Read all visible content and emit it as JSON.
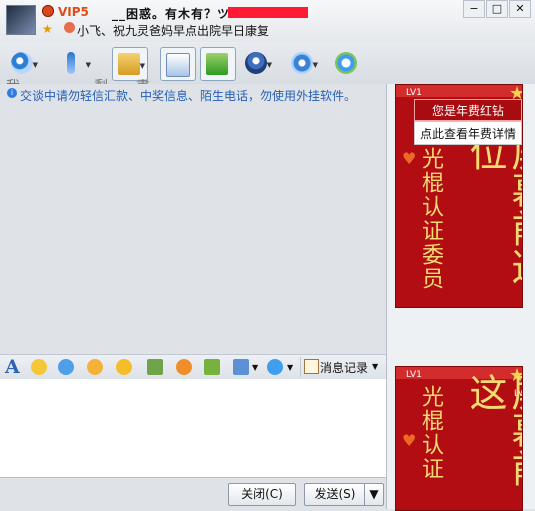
{
  "window": {
    "title": "__困惑。有木有？ツ",
    "vip_badge": "VIP5",
    "signature": "小飞、祝九灵爸妈早点出院早日康复",
    "controls": {
      "minimize": "−",
      "maximize": "□",
      "close": "✕"
    }
  },
  "toolbar": {
    "ghost_text_1": "我",
    "ghost_text_2": "剩",
    "ghost_text_3": "書",
    "icons": [
      "video-call-icon",
      "voice-call-icon",
      "send-file-icon",
      "mail-icon",
      "add-app-icon",
      "police-icon",
      "settings-icon",
      "soso-icon"
    ]
  },
  "notice": "交谈中请勿轻信汇款、中奖信息、陌生电话，勿使用外挂软件。",
  "ad": {
    "popup_vip": "您是年费红钻",
    "popup_detail": "点此查看年费详情",
    "level_badge": "LV1",
    "year_badge": "年",
    "side_text_1": "光棍认证委员",
    "side_text_2": "屏幕前这位",
    "side_text_3": "光棍认证",
    "side_text_4": "屏幕前这"
  },
  "edit_toolbar": {
    "font_label": "A",
    "message_record": "消息记录",
    "icons": [
      "font-icon",
      "emoji-icon",
      "magic-face-icon",
      "emoji-wink-icon",
      "shake-icon",
      "picture-icon",
      "music-icon",
      "score-icon",
      "screenshot-icon",
      "soso-small-icon"
    ]
  },
  "input": {
    "value": ""
  },
  "buttons": {
    "close": "关闭(C)",
    "send": "发送(S)",
    "send_menu": "▼"
  },
  "colors": {
    "accent_red": "#b10d13",
    "notice_blue": "#245fb5",
    "vip_orange": "#e34b13"
  }
}
